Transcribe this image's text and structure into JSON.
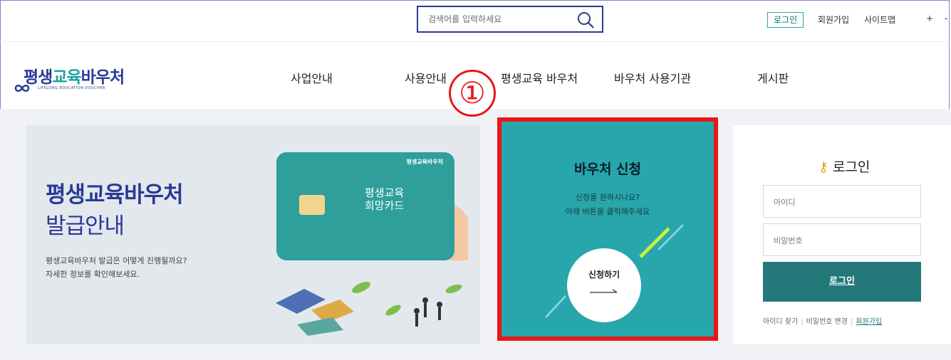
{
  "search": {
    "placeholder": "검색어를 입력하세요",
    "icon": "search-icon"
  },
  "util_nav": {
    "login": "로그인",
    "signup": "회원가입",
    "sitemap": "사이트맵",
    "plus": "+",
    "minus": "-"
  },
  "logo": {
    "main_a": "평생",
    "main_b": "교육",
    "main_c": "바우처",
    "sub": "LIFELONG EDUCATION VOUCHER"
  },
  "nav": {
    "items": [
      "사업안내",
      "사용안내",
      "평생교육 바우처",
      "바우처 사용기관",
      "게시판"
    ]
  },
  "banner": {
    "title1": "평생교육바우처",
    "title2": "발급안내",
    "desc1": "평생교육바우처 발급은 어떻게 진행될까요?",
    "desc2": "자세한 정보를 확인해보세요.",
    "card_logo": "평생교육바우처",
    "card_t1": "평생교육",
    "card_t2": "희망카드"
  },
  "voucher": {
    "title": "바우처 신청",
    "desc1": "신청을 원하시나요?",
    "desc2": "아래 버튼을 클릭해주세요",
    "button": "신청하기"
  },
  "annotation": {
    "number": "①",
    "color": "#e8161a"
  },
  "login": {
    "title": "로그인",
    "id_placeholder": "아이디",
    "pw_placeholder": "비밀번호",
    "button": "로그인",
    "find_id": "아이디 찾기",
    "change_pw": "비밀번호 변경",
    "join": "회원가입"
  },
  "colors": {
    "brand": "#2a3a96",
    "teal": "#27a6ab",
    "login_button": "#23787a",
    "highlight": "#e8161a"
  }
}
